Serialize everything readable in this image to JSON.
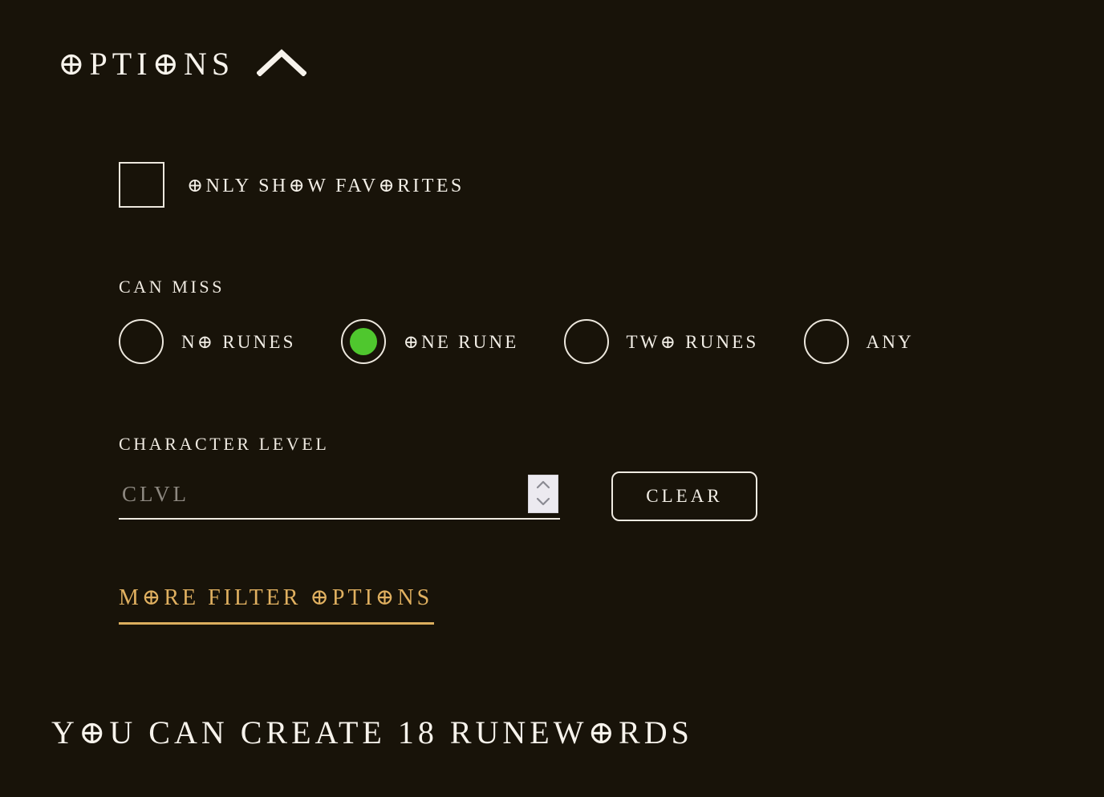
{
  "theme": {
    "background": "#181309",
    "text": "#f2eee6",
    "accent_gold": "#e0b060",
    "selected_green": "#4FC72E",
    "border": "#ece7dd"
  },
  "header": {
    "title": "⊕PTI⊕NS",
    "collapse_icon": "chevron-up-icon"
  },
  "favorites": {
    "label": "⊕NLY SH⊕W FAV⊕RITES",
    "checked": false
  },
  "can_miss": {
    "label": "CAN MISS",
    "selected_index": 1,
    "options": [
      {
        "label": "N⊕ RUNES",
        "value": "no-runes"
      },
      {
        "label": "⊕NE RUNE",
        "value": "one-rune"
      },
      {
        "label": "TW⊕ RUNES",
        "value": "two-runes"
      },
      {
        "label": "ANY",
        "value": "any"
      }
    ]
  },
  "character_level": {
    "label": "CHARACTER LEVEL",
    "placeholder": "CLVL",
    "value": "",
    "spinner_up_icon": "chevron-up-icon",
    "spinner_down_icon": "chevron-down-icon"
  },
  "clear_button": {
    "label": "CLEAR"
  },
  "more_filter_options": {
    "label": "M⊕RE FILTER ⊕PTI⊕NS"
  },
  "result": {
    "text": "Y⊕U CAN CREATE 18 RUNEW⊕RDS",
    "count": 18
  }
}
